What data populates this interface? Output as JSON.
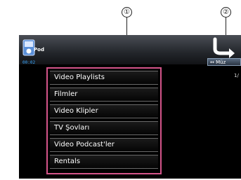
{
  "callouts": {
    "menu": "①",
    "mode": "②"
  },
  "status": {
    "source_label": "Pod",
    "elapsed": "00:02"
  },
  "header": {
    "mode_tab": "↔ Müz",
    "page_counter": "1/"
  },
  "menu": {
    "items": [
      {
        "label": "Video Playlists"
      },
      {
        "label": "Filmler"
      },
      {
        "label": "Video Klipler"
      },
      {
        "label": "TV Şovları"
      },
      {
        "label": "Video Podcast'ler"
      },
      {
        "label": "Rentals"
      }
    ]
  },
  "colors": {
    "highlight_border": "#d4548a",
    "time_text": "#3aa8ff"
  }
}
